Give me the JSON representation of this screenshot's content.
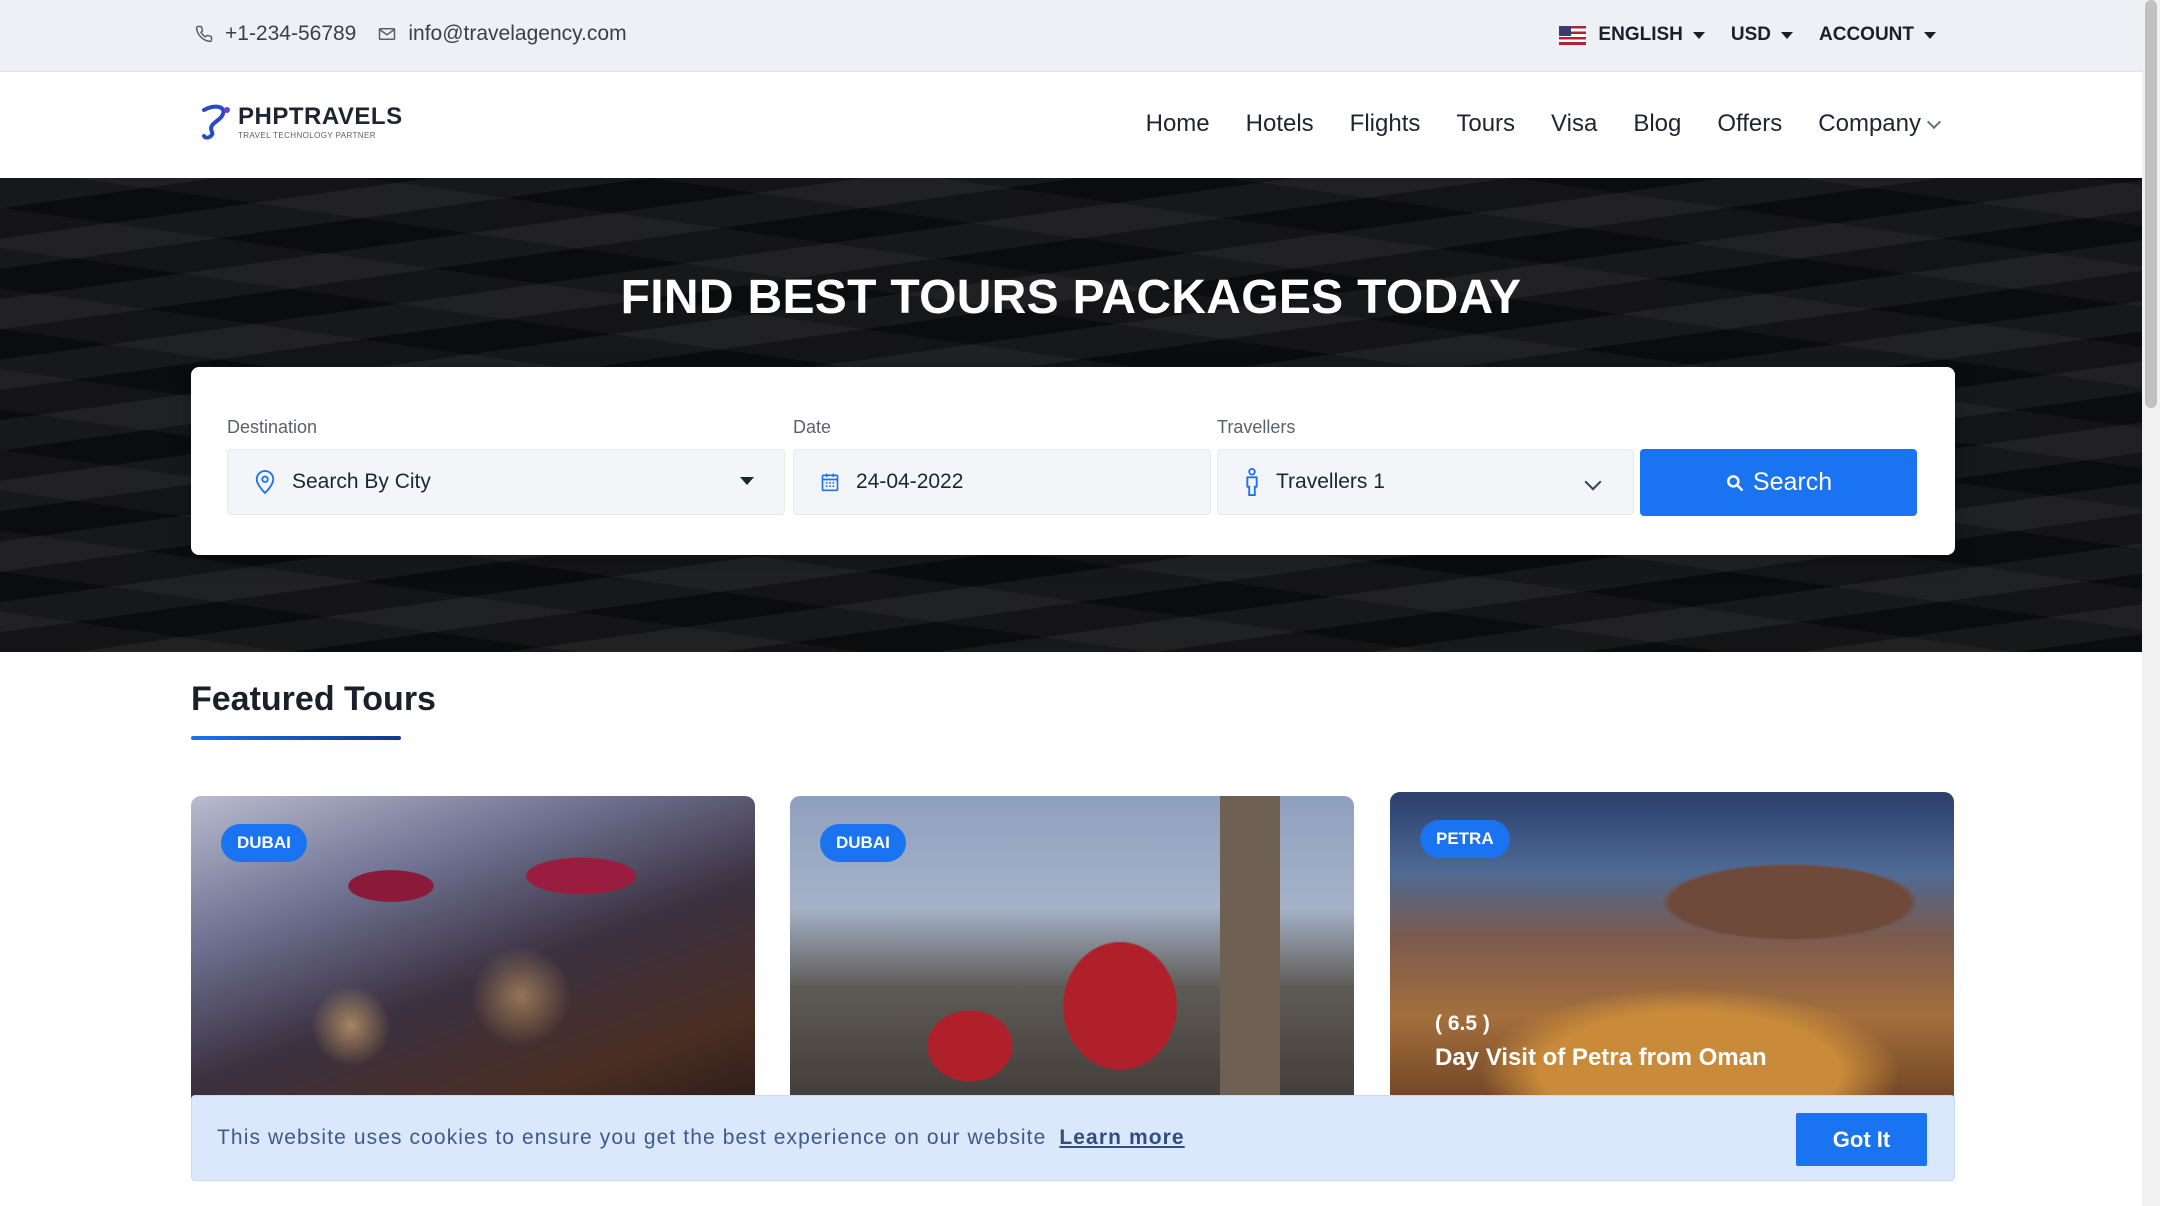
{
  "topbar": {
    "phone": "+1-234-56789",
    "email": "info@travelagency.com",
    "language": "ENGLISH",
    "currency": "USD",
    "account": "ACCOUNT"
  },
  "navbar": {
    "logo_brand": "PHPTRAVELS",
    "logo_tagline": "TRAVEL TECHNOLOGY PARTNER",
    "items": [
      "Home",
      "Hotels",
      "Flights",
      "Tours",
      "Visa",
      "Blog",
      "Offers",
      "Company"
    ]
  },
  "hero": {
    "title": "FIND BEST TOURS PACKAGES TODAY"
  },
  "search": {
    "destination_label": "Destination",
    "destination_value": "Search By City",
    "date_label": "Date",
    "date_value": "24-04-2022",
    "travellers_label": "Travellers",
    "travellers_value": "Travellers 1",
    "button_label": "Search"
  },
  "featured": {
    "title": "Featured Tours",
    "cards": [
      {
        "badge": "DUBAI"
      },
      {
        "badge": "DUBAI"
      },
      {
        "badge": "PETRA",
        "rating": "( 6.5 )",
        "name": "Day Visit of Petra from Oman"
      }
    ]
  },
  "cookie": {
    "message": "This website uses cookies to ensure you get the best experience on our website",
    "learn_more": "Learn more",
    "button": "Got It"
  },
  "colors": {
    "accent": "#1a73f0",
    "hero_bg": "#0b0c0e",
    "topbar_bg": "#edf0f5",
    "cookie_bg": "#dbe8fb"
  },
  "icons": {
    "phone": "phone-icon",
    "email": "mail-icon",
    "destination": "map-pin-icon",
    "date": "calendar-icon",
    "travellers": "person-icon",
    "search": "search-icon"
  }
}
